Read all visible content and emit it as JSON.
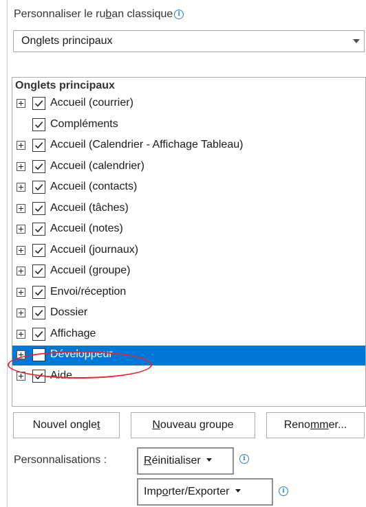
{
  "header": {
    "label_pre": "Personnaliser le ru",
    "label_accel": "b",
    "label_post": "an classique",
    "info_icon": "info-icon"
  },
  "dropdown": {
    "value": "Onglets principaux",
    "icon": "chevron-down-icon"
  },
  "tree": {
    "header": "Onglets principaux",
    "items": [
      {
        "label": "Accueil (courrier)",
        "checked": true,
        "expandable": true
      },
      {
        "label": "Compléments",
        "checked": true,
        "expandable": false
      },
      {
        "label": "Accueil (Calendrier - Affichage Tableau)",
        "checked": true,
        "expandable": true
      },
      {
        "label": "Accueil (calendrier)",
        "checked": true,
        "expandable": true
      },
      {
        "label": "Accueil (contacts)",
        "checked": true,
        "expandable": true
      },
      {
        "label": "Accueil (tâches)",
        "checked": true,
        "expandable": true
      },
      {
        "label": "Accueil (notes)",
        "checked": true,
        "expandable": true
      },
      {
        "label": "Accueil (journaux)",
        "checked": true,
        "expandable": true
      },
      {
        "label": "Accueil (groupe)",
        "checked": true,
        "expandable": true
      },
      {
        "label": "Envoi/réception",
        "checked": true,
        "expandable": true
      },
      {
        "label": "Dossier",
        "checked": true,
        "expandable": true
      },
      {
        "label": "Affichage",
        "checked": true,
        "expandable": true
      },
      {
        "label": "Développeur",
        "checked": false,
        "expandable": true,
        "selected": true
      },
      {
        "label": "Aide",
        "checked": true,
        "expandable": true
      }
    ],
    "selection_color": "#0078d7",
    "highlight_color": "#e8242f"
  },
  "buttons": {
    "new_tab_pre": "Nouvel ongle",
    "new_tab_accel": "t",
    "new_tab_post": "",
    "new_group_pre": "",
    "new_group_accel": "N",
    "new_group_post": "ouveau groupe",
    "rename_pre": "Reno",
    "rename_accel": "mm",
    "rename_post": "er..."
  },
  "customizations": {
    "label": "Personnalisations :",
    "reset_pre": "",
    "reset_accel": "R",
    "reset_post": "éinitialiser",
    "import_pre": "Imp",
    "import_accel": "o",
    "import_post": "rter/Exporter"
  }
}
